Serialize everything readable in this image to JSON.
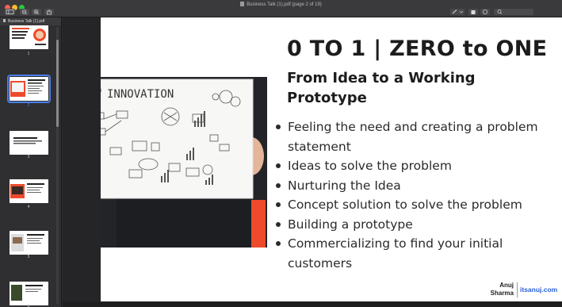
{
  "window": {
    "title": "Business Talk (1).pdf (page 2 of 19)"
  },
  "sidebar": {
    "header": "Business Talk (1).pdf",
    "thumbnails": [
      {
        "page": "1"
      },
      {
        "page": "2",
        "selected": true
      },
      {
        "page": "3"
      },
      {
        "page": "4"
      },
      {
        "page": "5"
      },
      {
        "page": "6"
      }
    ]
  },
  "slide": {
    "title": "0 TO 1 | ZERO to ONE",
    "subtitle": "From Idea to a Working Prototype",
    "illustration_label": "INNOVATION",
    "bullets": [
      "Feeling the need and creating a problem statement",
      "Ideas to solve the problem",
      "Nurturing the Idea",
      "Concept solution to solve the problem",
      "Building a prototype",
      "Commercializing to find your initial customers"
    ],
    "footer_name": "Anuj Sharma",
    "footer_site": "itsanuj.com"
  },
  "colors": {
    "accent_red": "#ee4a2b",
    "link_blue": "#2a62d4",
    "selection_blue": "#4a7ee8"
  }
}
